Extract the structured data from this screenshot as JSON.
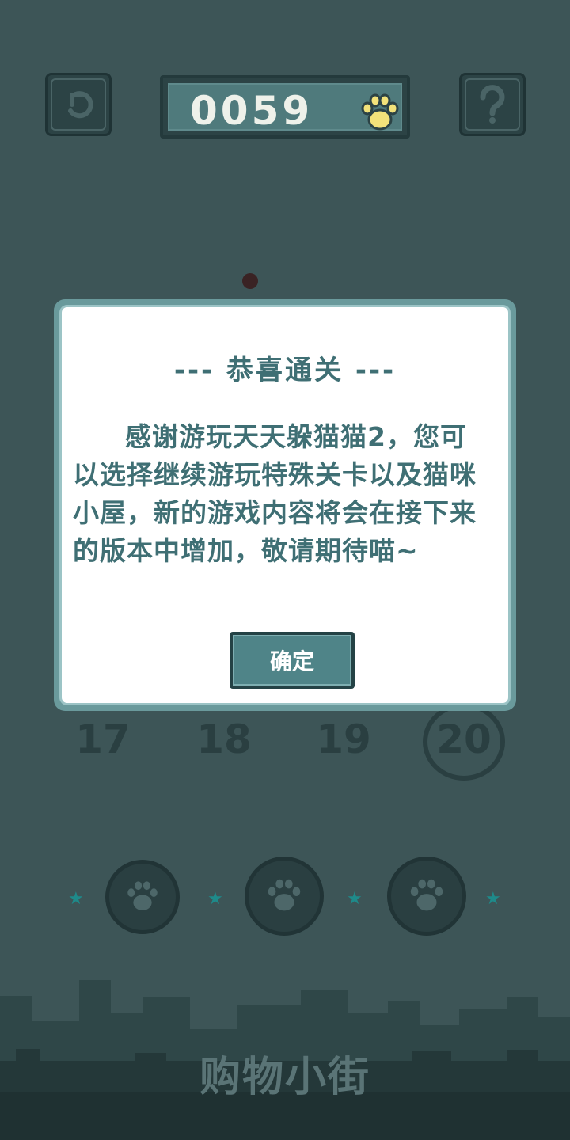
{
  "header": {
    "score": "0059",
    "undo_icon": "undo-icon",
    "help_icon": "question-mark-icon",
    "currency_icon": "paw-icon"
  },
  "levels": [
    {
      "label": "17"
    },
    {
      "label": "18"
    },
    {
      "label": "19"
    },
    {
      "label": "20"
    }
  ],
  "dialog": {
    "title": "--- 恭喜通关 ---",
    "body": "感谢游玩天天躲猫猫2，您可以选择继续游玩特殊关卡以及猫咪小屋，新的游戏内容将会在接下来的版本中增加，敬请期待喵~",
    "confirm_label": "确定"
  },
  "footer": {
    "shop_label": "购物小街"
  },
  "colors": {
    "background": "#3d5557",
    "dialog_text": "#3f6f74",
    "accent_star": "#1e8a8a",
    "paw_yellow": "#f2e27a"
  }
}
